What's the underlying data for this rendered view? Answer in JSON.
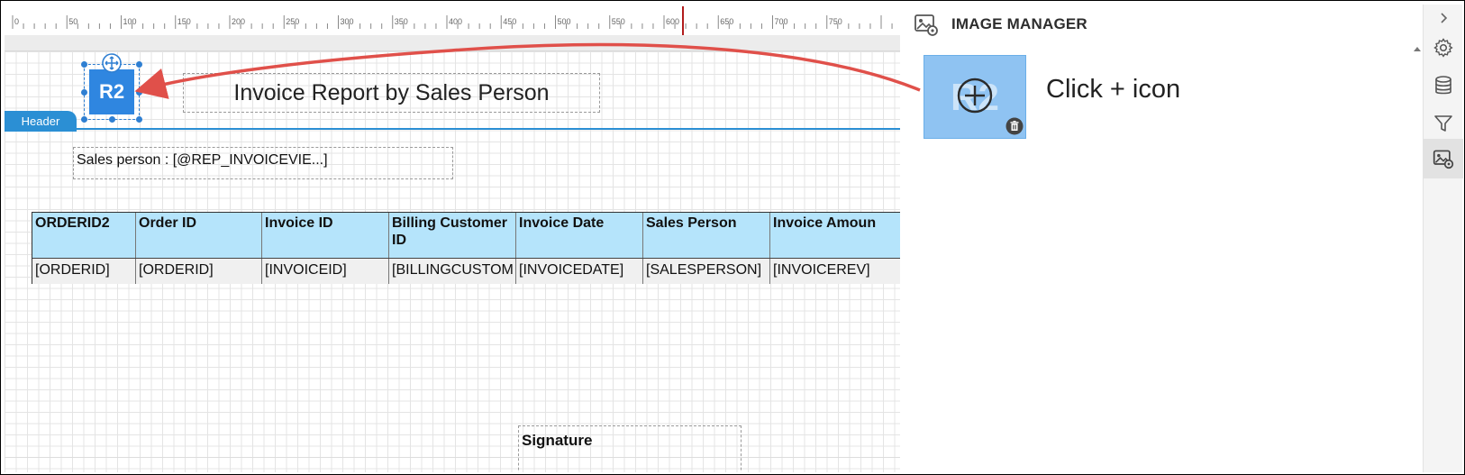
{
  "designer": {
    "ruler_labels": [
      "0",
      "50",
      "100",
      "150",
      "200",
      "250",
      "300",
      "350",
      "400",
      "450",
      "500",
      "550",
      "600",
      "650",
      "700",
      "750"
    ],
    "logo_text": "R2",
    "title": "Invoice Report by Sales Person",
    "band_label": "Header",
    "sales_person": "Sales person : [@REP_INVOICEVIE...]",
    "signature": "Signature",
    "table": {
      "headers": [
        "ORDERID2",
        "Order ID",
        "Invoice ID",
        "Billing Customer ID",
        "Invoice Date",
        "Sales Person",
        "Invoice Amoun"
      ],
      "row": [
        "[ORDERID]",
        "[ORDERID]",
        "[INVOICEID]",
        "[BILLINGCUSTOM",
        "[INVOICEDATE]",
        "[SALESPERSON]",
        "[INVOICEREV]"
      ]
    }
  },
  "panel": {
    "title": "IMAGE MANAGER",
    "thumb_text": "R2",
    "hint": "Click + icon"
  },
  "toolbar": {
    "items": [
      "chevron-right-icon",
      "gear-icon",
      "database-icon",
      "filter-icon",
      "image-settings-icon"
    ],
    "active": "image-settings-icon"
  },
  "colors": {
    "accent": "#2b8fd4",
    "table_header": "#b5e4fb",
    "annotation_arrow": "#e0504a",
    "thumb_bg": "#8fc3f2"
  }
}
